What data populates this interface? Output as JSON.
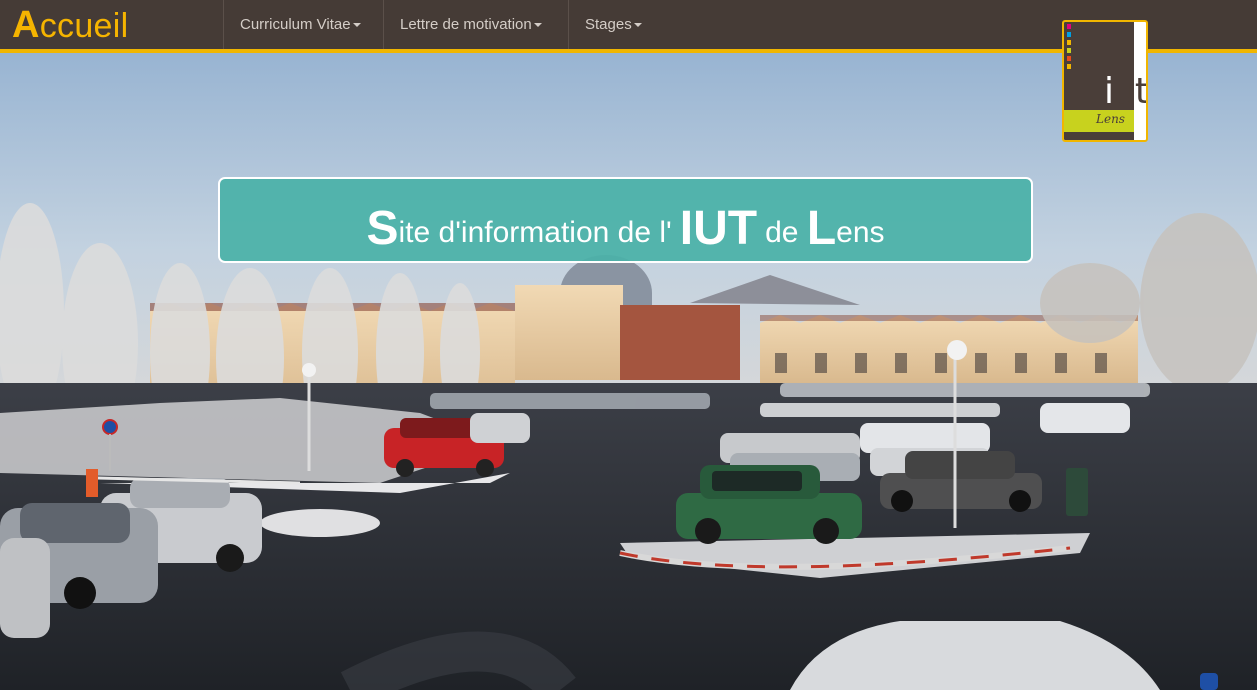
{
  "navbar": {
    "brand_initial": "A",
    "brand_rest": "ccueil",
    "menu": [
      {
        "label": "Curriculum Vitae"
      },
      {
        "label": "Lettre de motivation"
      },
      {
        "label": "Stages"
      }
    ]
  },
  "logo": {
    "main_i": "i",
    "main_ut": "ut",
    "sub": "Lens"
  },
  "banner": {
    "s_initial": "S",
    "part1": "ite d'information de l'",
    "iut": "IUT",
    "part2": "de",
    "l_initial": "L",
    "part3": "ens"
  },
  "colors": {
    "navbar_bg": "#453b36",
    "accent": "#f1b600",
    "banner_bg": "#4ab2a8",
    "logo_lime": "#c8d21e"
  },
  "icons": {
    "dropdown": "caret-down-icon"
  }
}
